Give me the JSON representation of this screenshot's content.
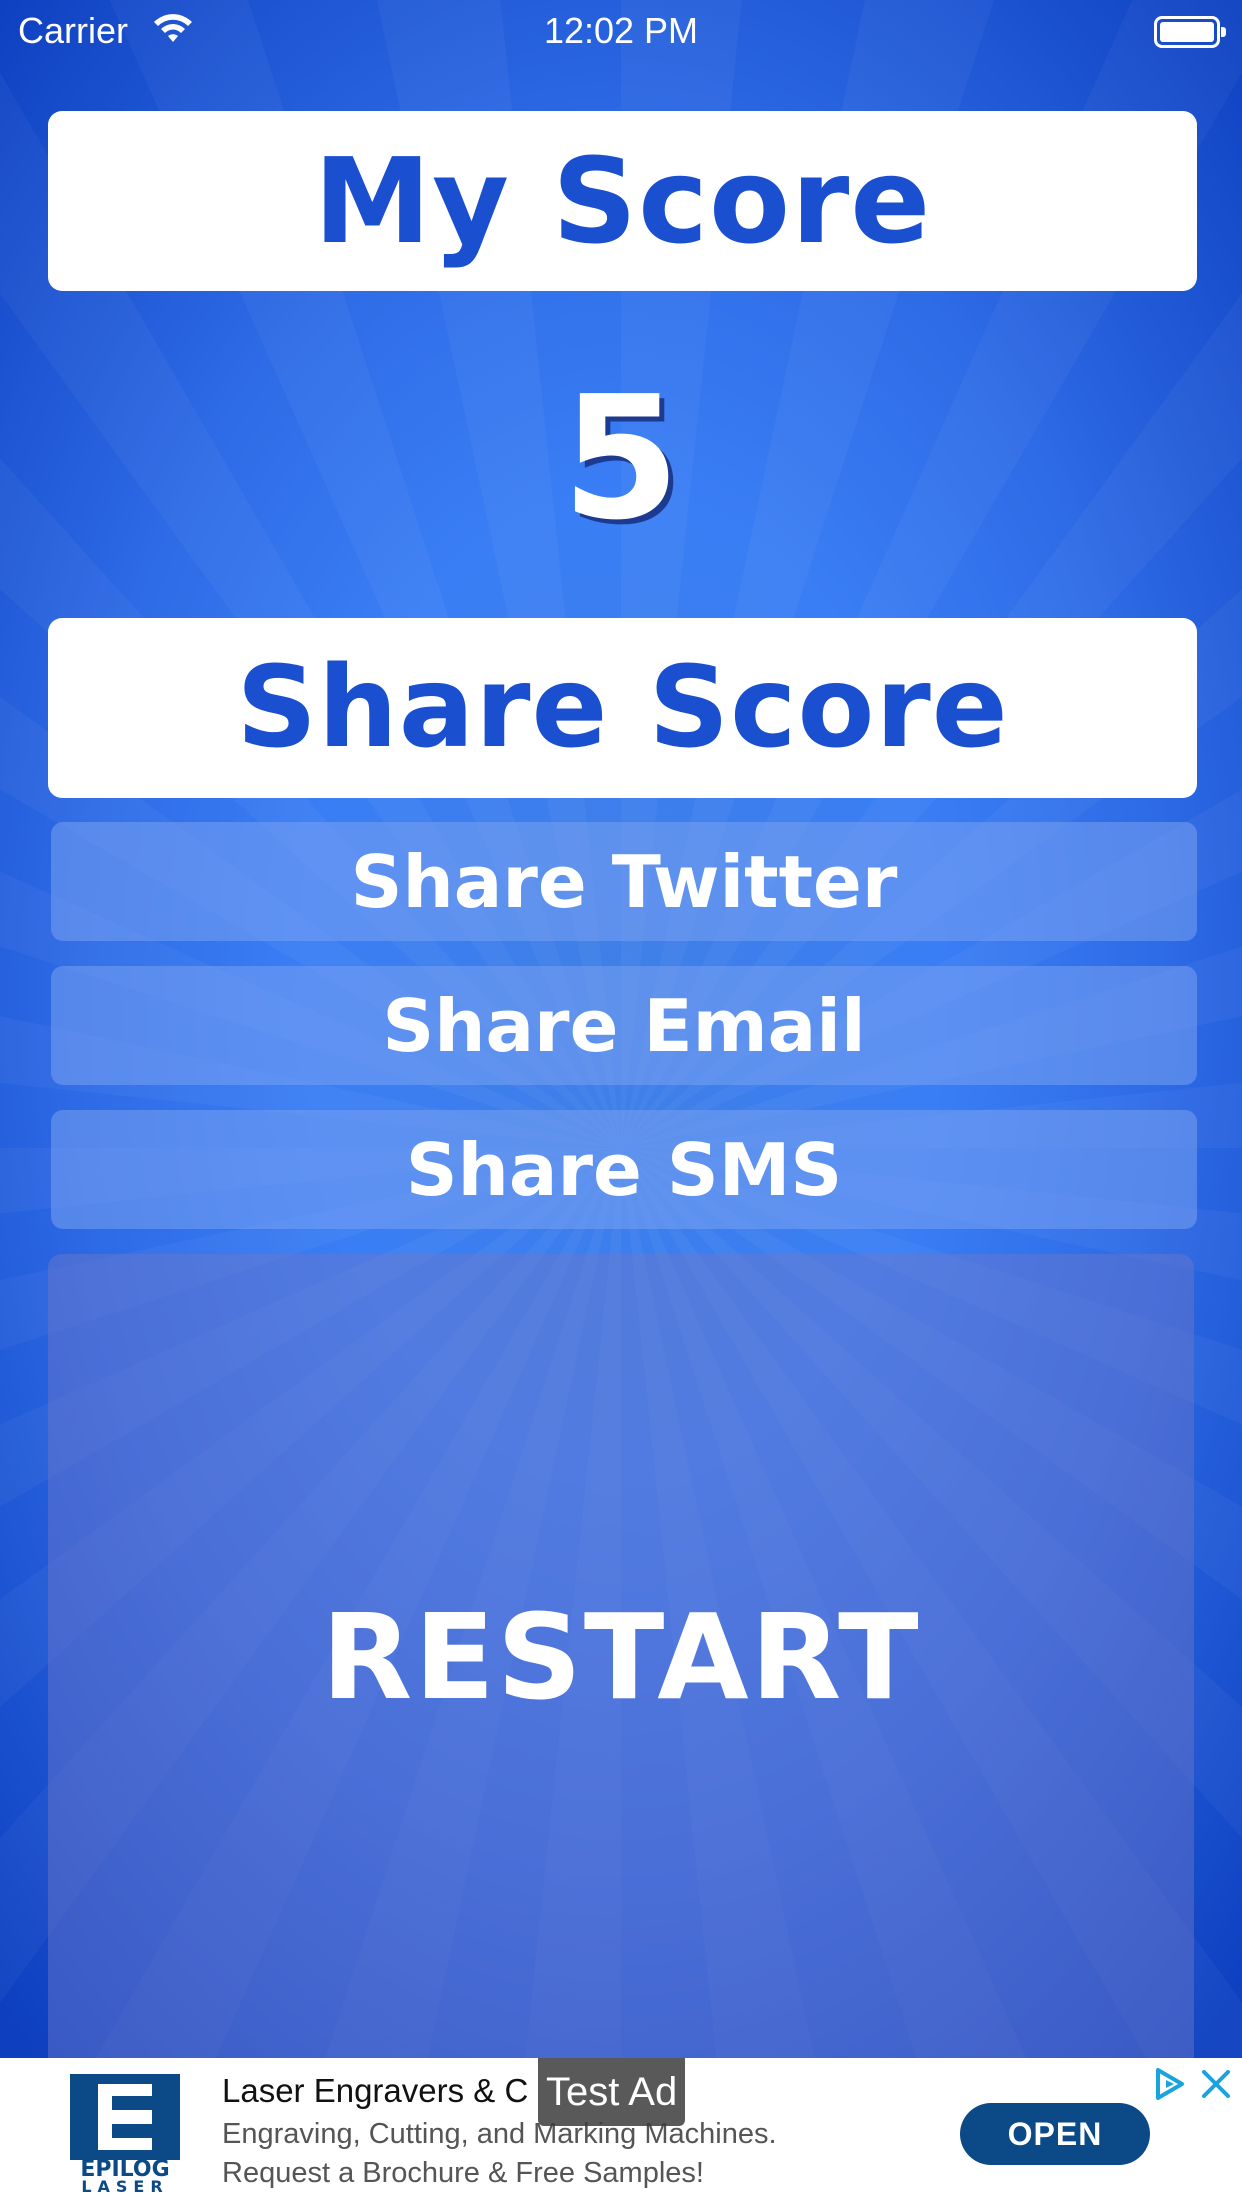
{
  "status_bar": {
    "carrier": "Carrier",
    "time": "12:02 PM"
  },
  "screen": {
    "title": "My Score",
    "score": "5",
    "share_score_label": "Share Score",
    "share_twitter_label": "Share Twitter",
    "share_email_label": "Share Email",
    "share_sms_label": "Share SMS",
    "restart_label": "RESTART"
  },
  "ad": {
    "logo_text_top": "EPILOG",
    "logo_text_bottom": "LASER",
    "headline": "Laser Engravers & C",
    "line1": "Engraving, Cutting, and Marking Machines.",
    "line2": "Request a Brochure & Free Samples!",
    "test_label": "Test Ad",
    "cta": "OPEN"
  },
  "colors": {
    "accent_text": "#1a4fd0",
    "background": "#3a7ef5",
    "ad_button": "#0b4a86"
  }
}
